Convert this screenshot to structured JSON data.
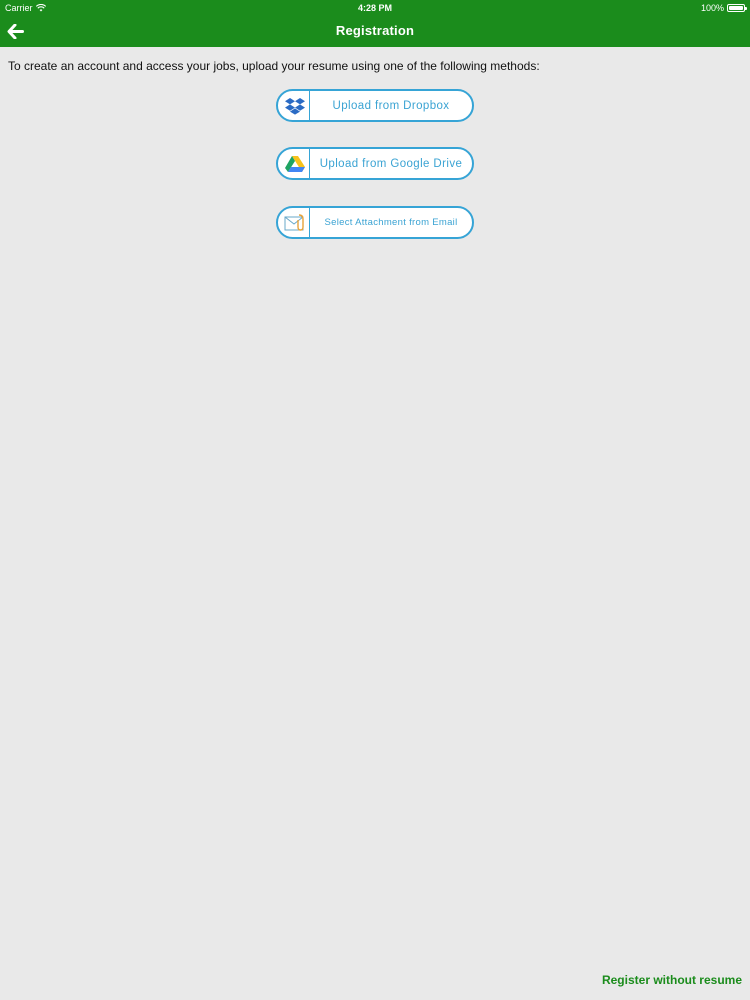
{
  "status_bar": {
    "carrier": "Carrier",
    "time": "4:28 PM",
    "battery": "100%"
  },
  "nav": {
    "title": "Registration",
    "back_icon": "arrow-left-icon"
  },
  "intro_text": "To create an account and access your jobs, upload your resume using one of the following methods:",
  "upload_options": [
    {
      "label": "Upload from Dropbox",
      "icon": "dropbox-icon"
    },
    {
      "label": "Upload from Google Drive",
      "icon": "google-drive-icon"
    },
    {
      "label": "Select Attachment from Email",
      "icon": "email-attachment-icon"
    }
  ],
  "footer": {
    "register_without_resume": "Register without resume"
  },
  "colors": {
    "brand_green": "#1b8c1c",
    "button_border": "#36a4d6",
    "background": "#e9e9e9"
  }
}
